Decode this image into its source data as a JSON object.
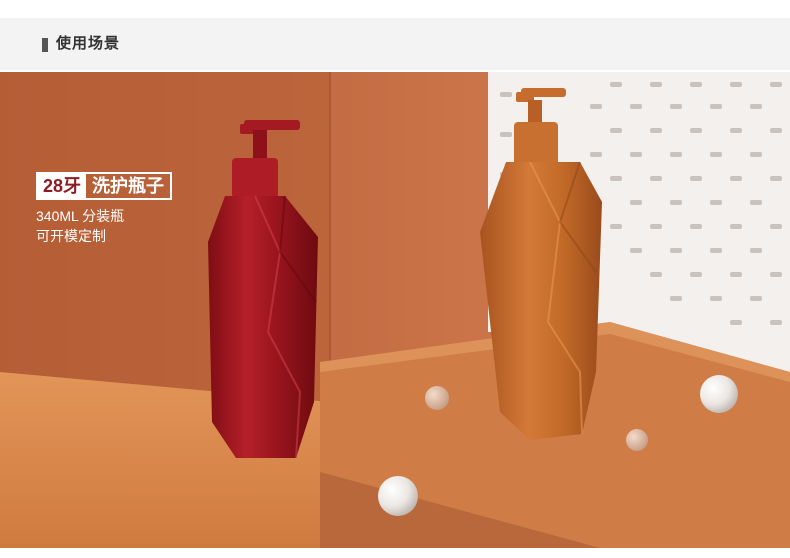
{
  "header": {
    "title": "使用场景"
  },
  "caption": {
    "tag_number": "28牙",
    "tag_text": "洗护瓶子",
    "line1": "340ML 分装瓶",
    "line2": "可开模定制"
  },
  "colors": {
    "wall": "#c96e45",
    "floor": "#d9864f",
    "red_bottle": "#a9161f",
    "orange_bottle": "#c86a2c",
    "pegboard": "#f2f0ee"
  }
}
